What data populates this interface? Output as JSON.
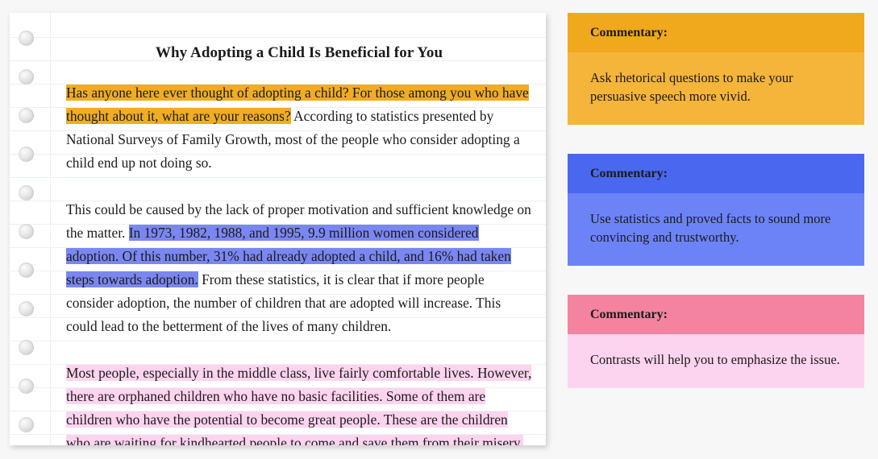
{
  "paper": {
    "title": "Why Adopting a Child Is Beneficial for You",
    "hole_count": 11,
    "paragraphs": {
      "p1": {
        "highlighted": "Has anyone here ever thought of adopting a child? For those among you who have thought about it, what are your reasons?",
        "rest": " According to statistics presented by National Surveys of Family Growth, most of the people who consider adopting a child end up not doing so."
      },
      "p2": {
        "lead": "This could be caused by the lack of proper motivation and sufficient knowledge on the matter. ",
        "highlighted": "In 1973, 1982, 1988, and 1995, 9.9 million women considered adoption. Of this number, 31% had already adopted a child, and 16% had taken steps towards adoption.",
        "rest": " From these statistics, it is clear that if more people consider adoption, the number of children that are adopted will increase. This could lead to the betterment of the lives of many children."
      },
      "p3": {
        "highlighted": "Most people, especially in the middle class, live fairly comfortable lives. However, there are orphaned children who have no basic facilities. Some of them are children who have the potential to become great people. These are the children who are waiting for kindhearted people to come and save them from their misery."
      }
    }
  },
  "commentary": {
    "cards": [
      {
        "id": "orange",
        "header": "Commentary:",
        "body": "Ask rhetorical questions to make your persuasive speech more vivid.",
        "header_color": "#f0a81d",
        "body_color": "#f5b43a"
      },
      {
        "id": "blue",
        "header": "Commentary:",
        "body": "Use statistics and proved facts to sound more convincing and trustworthy.",
        "header_color": "#4a68ef",
        "body_color": "#6c83f7"
      },
      {
        "id": "pink",
        "header": "Commentary:",
        "body": "Contrasts will help you to emphasize the issue.",
        "header_color": "#f3839f",
        "body_color": "#fdd4ef"
      }
    ]
  },
  "colors": {
    "background": "#f7f7f8",
    "paper": "#ffffff",
    "rule_line": "#eaf2f0",
    "margin_line": "#f0eef0",
    "highlight_orange": "#f0ad22",
    "highlight_blue": "#7b87f0",
    "highlight_pink": "#fdd4ef",
    "text": "#1b1b1b"
  }
}
